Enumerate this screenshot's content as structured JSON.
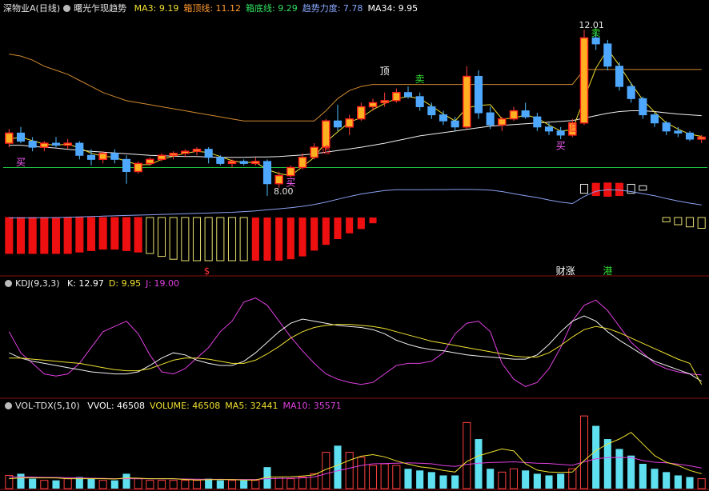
{
  "panels": {
    "main": {
      "security": "深物业A(日线)",
      "indicator": "曙光乍现趋势",
      "stats": [
        {
          "label": "MA3",
          "value": "9.19",
          "color": "#f0e030"
        },
        {
          "label": "箱顶线",
          "value": "11.12",
          "color": "#ff9a30"
        },
        {
          "label": "箱底线",
          "value": "9.29",
          "color": "#30e060"
        },
        {
          "label": "趋势力度",
          "value": "7.78",
          "color": "#8aa8ff"
        },
        {
          "label": "MA34",
          "value": "9.95",
          "color": "#ffffff"
        }
      ]
    },
    "kdj": {
      "name": "KDJ(9,3,3)",
      "stats": [
        {
          "label": "K",
          "value": "12.97",
          "color": "#ffffff"
        },
        {
          "label": "D",
          "value": "9.95",
          "color": "#f0e030"
        },
        {
          "label": "J",
          "value": "19.00",
          "color": "#e040e0"
        }
      ]
    },
    "vol": {
      "name": "VOL-TDX(5,10)",
      "stats": [
        {
          "label": "VVOL",
          "value": "46508",
          "color": "#ffffff"
        },
        {
          "label": "VOLUME",
          "value": "46508",
          "color": "#f0e030"
        },
        {
          "label": "MA5",
          "value": "32441",
          "color": "#f0e030"
        },
        {
          "label": "MA10",
          "value": "35571",
          "color": "#e040e0"
        }
      ]
    }
  },
  "chart_data": {
    "type": "candlestick",
    "count": 60,
    "price_range": [
      7.9,
      12.4
    ],
    "candles": [
      {
        "o": 9.3,
        "h": 9.65,
        "l": 9.2,
        "c": 9.55
      },
      {
        "o": 9.55,
        "h": 9.7,
        "l": 9.3,
        "c": 9.35
      },
      {
        "o": 9.35,
        "h": 9.45,
        "l": 9.1,
        "c": 9.2
      },
      {
        "o": 9.2,
        "h": 9.35,
        "l": 9.1,
        "c": 9.3
      },
      {
        "o": 9.3,
        "h": 9.45,
        "l": 9.2,
        "c": 9.25
      },
      {
        "o": 9.25,
        "h": 9.4,
        "l": 9.15,
        "c": 9.3
      },
      {
        "o": 9.3,
        "h": 9.35,
        "l": 8.9,
        "c": 9.0
      },
      {
        "o": 9.0,
        "h": 9.15,
        "l": 8.75,
        "c": 8.9
      },
      {
        "o": 8.9,
        "h": 9.1,
        "l": 8.8,
        "c": 9.05
      },
      {
        "o": 9.05,
        "h": 9.15,
        "l": 8.8,
        "c": 8.9
      },
      {
        "o": 8.9,
        "h": 9.0,
        "l": 8.3,
        "c": 8.6
      },
      {
        "o": 8.6,
        "h": 8.85,
        "l": 8.55,
        "c": 8.8
      },
      {
        "o": 8.8,
        "h": 8.95,
        "l": 8.75,
        "c": 8.9
      },
      {
        "o": 8.9,
        "h": 9.05,
        "l": 8.85,
        "c": 9.0
      },
      {
        "o": 9.0,
        "h": 9.1,
        "l": 8.9,
        "c": 9.05
      },
      {
        "o": 9.05,
        "h": 9.15,
        "l": 8.95,
        "c": 9.1
      },
      {
        "o": 9.1,
        "h": 9.2,
        "l": 9.0,
        "c": 9.15
      },
      {
        "o": 9.15,
        "h": 9.2,
        "l": 8.8,
        "c": 8.95
      },
      {
        "o": 8.95,
        "h": 9.0,
        "l": 8.75,
        "c": 8.8
      },
      {
        "o": 8.8,
        "h": 8.9,
        "l": 8.7,
        "c": 8.85
      },
      {
        "o": 8.85,
        "h": 8.9,
        "l": 8.75,
        "c": 8.8
      },
      {
        "o": 8.8,
        "h": 8.95,
        "l": 8.75,
        "c": 8.85
      },
      {
        "o": 8.85,
        "h": 8.9,
        "l": 8.0,
        "c": 8.3
      },
      {
        "o": 8.3,
        "h": 8.6,
        "l": 8.2,
        "c": 8.5
      },
      {
        "o": 8.5,
        "h": 8.75,
        "l": 8.45,
        "c": 8.7
      },
      {
        "o": 8.7,
        "h": 9.05,
        "l": 8.65,
        "c": 8.95
      },
      {
        "o": 8.95,
        "h": 9.3,
        "l": 8.9,
        "c": 9.2
      },
      {
        "o": 9.2,
        "h": 9.9,
        "l": 9.15,
        "c": 9.85
      },
      {
        "o": 9.85,
        "h": 10.25,
        "l": 9.6,
        "c": 9.7
      },
      {
        "o": 9.7,
        "h": 10.0,
        "l": 9.5,
        "c": 9.9
      },
      {
        "o": 9.9,
        "h": 10.3,
        "l": 9.85,
        "c": 10.2
      },
      {
        "o": 10.2,
        "h": 10.4,
        "l": 10.1,
        "c": 10.3
      },
      {
        "o": 10.3,
        "h": 10.55,
        "l": 10.2,
        "c": 10.35
      },
      {
        "o": 10.35,
        "h": 10.65,
        "l": 10.3,
        "c": 10.55
      },
      {
        "o": 10.55,
        "h": 10.7,
        "l": 10.4,
        "c": 10.45
      },
      {
        "o": 10.45,
        "h": 10.55,
        "l": 10.1,
        "c": 10.2
      },
      {
        "o": 10.2,
        "h": 10.3,
        "l": 9.9,
        "c": 10.0
      },
      {
        "o": 10.0,
        "h": 10.1,
        "l": 9.75,
        "c": 9.85
      },
      {
        "o": 9.85,
        "h": 9.95,
        "l": 9.6,
        "c": 9.7
      },
      {
        "o": 9.7,
        "h": 11.2,
        "l": 9.65,
        "c": 10.95
      },
      {
        "o": 10.95,
        "h": 11.1,
        "l": 9.9,
        "c": 10.05
      },
      {
        "o": 10.05,
        "h": 10.2,
        "l": 9.65,
        "c": 9.75
      },
      {
        "o": 9.75,
        "h": 9.95,
        "l": 9.6,
        "c": 9.9
      },
      {
        "o": 9.9,
        "h": 10.2,
        "l": 9.85,
        "c": 10.1
      },
      {
        "o": 10.1,
        "h": 10.3,
        "l": 9.9,
        "c": 9.95
      },
      {
        "o": 9.95,
        "h": 10.05,
        "l": 9.6,
        "c": 9.7
      },
      {
        "o": 9.7,
        "h": 9.8,
        "l": 9.5,
        "c": 9.6
      },
      {
        "o": 9.6,
        "h": 9.7,
        "l": 9.4,
        "c": 9.5
      },
      {
        "o": 9.5,
        "h": 9.9,
        "l": 9.45,
        "c": 9.8
      },
      {
        "o": 9.8,
        "h": 12.1,
        "l": 9.75,
        "c": 11.9
      },
      {
        "o": 11.9,
        "h": 12.05,
        "l": 11.6,
        "c": 11.75
      },
      {
        "o": 11.75,
        "h": 11.85,
        "l": 11.1,
        "c": 11.2
      },
      {
        "o": 11.2,
        "h": 11.3,
        "l": 10.6,
        "c": 10.7
      },
      {
        "o": 10.7,
        "h": 10.8,
        "l": 10.3,
        "c": 10.4
      },
      {
        "o": 10.4,
        "h": 10.45,
        "l": 9.9,
        "c": 10.0
      },
      {
        "o": 10.0,
        "h": 10.05,
        "l": 9.7,
        "c": 9.8
      },
      {
        "o": 9.8,
        "h": 9.85,
        "l": 9.5,
        "c": 9.6
      },
      {
        "o": 9.6,
        "h": 9.7,
        "l": 9.45,
        "c": 9.55
      },
      {
        "o": 9.55,
        "h": 9.6,
        "l": 9.35,
        "c": 9.4
      },
      {
        "o": 9.4,
        "h": 9.5,
        "l": 9.3,
        "c": 9.45
      }
    ],
    "ma3": [
      9.4,
      9.45,
      9.36,
      9.28,
      9.25,
      9.28,
      9.18,
      9.05,
      8.98,
      8.95,
      8.85,
      8.77,
      8.77,
      8.9,
      8.98,
      9.05,
      9.1,
      9.07,
      8.97,
      8.87,
      8.82,
      8.83,
      8.65,
      8.55,
      8.5,
      8.72,
      8.95,
      9.33,
      9.58,
      9.82,
      9.93,
      10.13,
      10.28,
      10.4,
      10.45,
      10.4,
      10.22,
      10.02,
      9.85,
      10.17,
      10.23,
      10.25,
      9.9,
      9.92,
      10.0,
      9.92,
      9.75,
      9.6,
      9.63,
      10.4,
      11.15,
      11.62,
      11.22,
      10.77,
      10.37,
      10.07,
      9.8,
      9.65,
      9.52,
      9.47
    ],
    "ma34": [
      9.25,
      9.25,
      9.22,
      9.2,
      9.18,
      9.15,
      9.13,
      9.1,
      9.08,
      9.06,
      9.04,
      9.02,
      9.0,
      8.99,
      8.98,
      8.97,
      8.97,
      8.96,
      8.95,
      8.95,
      8.95,
      8.96,
      8.96,
      8.97,
      8.99,
      9.01,
      9.04,
      9.08,
      9.12,
      9.16,
      9.2,
      9.25,
      9.3,
      9.36,
      9.42,
      9.48,
      9.52,
      9.56,
      9.6,
      9.64,
      9.68,
      9.72,
      9.74,
      9.76,
      9.78,
      9.8,
      9.82,
      9.84,
      9.86,
      9.92,
      9.98,
      10.04,
      10.08,
      10.1,
      10.1,
      10.08,
      10.05,
      10.02,
      10.0,
      9.98
    ],
    "box_top": [
      11.5,
      11.45,
      11.35,
      11.2,
      11.1,
      11.0,
      10.85,
      10.7,
      10.55,
      10.45,
      10.35,
      10.3,
      10.25,
      10.2,
      10.15,
      10.1,
      10.05,
      10.0,
      9.95,
      9.9,
      9.85,
      9.85,
      9.85,
      9.85,
      9.85,
      9.85,
      9.85,
      10.1,
      10.4,
      10.6,
      10.7,
      10.75,
      10.75,
      10.75,
      10.75,
      10.75,
      10.75,
      10.75,
      10.75,
      10.75,
      10.75,
      10.75,
      10.75,
      10.75,
      10.75,
      10.75,
      10.75,
      10.75,
      10.75,
      11.12,
      11.12,
      11.12,
      11.12,
      11.12,
      11.12,
      11.12,
      11.12,
      11.12,
      11.12,
      11.12
    ],
    "box_bottom_level": 8.7,
    "trend": [
      1.7,
      1.7,
      1.72,
      1.75,
      1.8,
      1.9,
      2.0,
      2.1,
      2.2,
      2.3,
      2.4,
      2.5,
      2.6,
      2.7,
      2.8,
      2.9,
      3.0,
      3.1,
      3.2,
      3.3,
      3.5,
      3.7,
      4.0,
      4.3,
      4.6,
      5.0,
      5.5,
      6.2,
      7.0,
      7.8,
      8.5,
      9.0,
      9.5,
      9.7,
      9.7,
      9.7,
      9.75,
      9.75,
      9.8,
      9.8,
      9.75,
      9.6,
      9.2,
      8.6,
      8.0,
      7.5,
      6.8,
      6.2,
      5.8,
      7.8,
      9.3,
      9.7,
      9.6,
      9.2,
      8.6,
      8.0,
      7.2,
      6.5,
      5.9,
      5.4
    ],
    "hist": [
      -5,
      -5,
      -5,
      -5,
      -5,
      -5,
      -4.8,
      -4.6,
      -4.4,
      -4.4,
      -4.6,
      -4.8,
      -5,
      -5.4,
      -5.8,
      -6,
      -6,
      -6,
      -6,
      -6,
      -6,
      -6,
      -6,
      -6,
      -5.8,
      -5.4,
      -4.6,
      -3.8,
      -3.0,
      -2.2,
      -1.6,
      -0.8,
      0,
      0,
      0,
      0,
      0,
      0,
      0,
      0,
      0,
      0,
      0,
      0,
      0,
      0,
      0,
      0,
      0,
      1.6,
      2.2,
      2.4,
      2.2,
      1.6,
      0.8,
      0,
      -0.6,
      -1.0,
      -1.3,
      -1.5
    ],
    "kdj": {
      "k": [
        40,
        35,
        32,
        30,
        28,
        26,
        24,
        22,
        21,
        20,
        20,
        22,
        28,
        35,
        40,
        38,
        33,
        30,
        28,
        28,
        32,
        40,
        50,
        60,
        68,
        72,
        70,
        68,
        66,
        65,
        64,
        62,
        58,
        52,
        48,
        45,
        43,
        42,
        40,
        38,
        37,
        36,
        35,
        34,
        34,
        38,
        48,
        60,
        70,
        75,
        70,
        60,
        52,
        45,
        38,
        32,
        28,
        24,
        20,
        13
      ],
      "d": [
        35,
        35,
        34,
        33,
        32,
        31,
        30,
        28,
        26,
        24,
        23,
        23,
        25,
        29,
        33,
        35,
        35,
        34,
        32,
        30,
        30,
        33,
        39,
        46,
        54,
        60,
        64,
        66,
        67,
        67,
        66,
        65,
        63,
        60,
        57,
        54,
        51,
        49,
        47,
        45,
        43,
        41,
        39,
        37,
        36,
        36,
        40,
        47,
        55,
        62,
        65,
        63,
        59,
        54,
        49,
        44,
        39,
        34,
        30,
        10
      ],
      "j": [
        60,
        40,
        30,
        20,
        18,
        20,
        30,
        45,
        60,
        65,
        70,
        58,
        38,
        22,
        20,
        25,
        35,
        45,
        60,
        70,
        88,
        92,
        85,
        70,
        55,
        42,
        30,
        20,
        15,
        12,
        10,
        12,
        20,
        28,
        30,
        30,
        32,
        40,
        58,
        68,
        70,
        60,
        30,
        15,
        8,
        12,
        25,
        45,
        70,
        85,
        90,
        80,
        65,
        50,
        40,
        30,
        25,
        22,
        20,
        19
      ]
    },
    "volume": {
      "bars": [
        8,
        9,
        6,
        5,
        5,
        6,
        7,
        6,
        5,
        5,
        9,
        6,
        5,
        5,
        5,
        5,
        5,
        6,
        5,
        5,
        5,
        5,
        13,
        7,
        6,
        7,
        9,
        22,
        26,
        22,
        19,
        14,
        15,
        14,
        12,
        11,
        10,
        8,
        8,
        40,
        30,
        12,
        10,
        12,
        11,
        9,
        8,
        9,
        12,
        44,
        38,
        30,
        24,
        20,
        15,
        12,
        10,
        8,
        7,
        6
      ],
      "up": [
        1,
        0,
        0,
        1,
        0,
        1,
        0,
        0,
        1,
        0,
        0,
        1,
        1,
        1,
        1,
        1,
        1,
        0,
        0,
        1,
        0,
        1,
        0,
        1,
        1,
        1,
        1,
        1,
        0,
        1,
        1,
        1,
        1,
        1,
        0,
        0,
        0,
        0,
        0,
        1,
        0,
        0,
        1,
        1,
        0,
        0,
        0,
        0,
        1,
        1,
        0,
        0,
        0,
        0,
        0,
        0,
        0,
        0,
        0,
        1
      ],
      "ma5": [
        6,
        6.5,
        6.5,
        6.5,
        6.5,
        6,
        6,
        6,
        6,
        5.8,
        6.5,
        6.3,
        6,
        6,
        6,
        5.5,
        5.2,
        5.4,
        5.4,
        5.4,
        5.2,
        5.2,
        7,
        7,
        7.2,
        7.6,
        8.4,
        11.6,
        14.2,
        17.2,
        19.6,
        20.6,
        19.2,
        16.8,
        14.8,
        13.2,
        12.4,
        11,
        10,
        16.4,
        19.8,
        22,
        24,
        22.8,
        15,
        11.2,
        10,
        9.8,
        10,
        17,
        23,
        27,
        30,
        34,
        27,
        20,
        16,
        14,
        11,
        9
      ],
      "ma10": [
        7,
        7,
        7,
        6.8,
        6.8,
        6.6,
        6.5,
        6.3,
        6.2,
        6,
        6,
        6,
        5.9,
        5.9,
        5.9,
        5.8,
        5.7,
        5.6,
        5.6,
        5.5,
        5.5,
        5.5,
        6,
        6.2,
        6.3,
        6.5,
        7,
        9,
        10.8,
        12.4,
        14,
        15,
        15.2,
        15.4,
        15.6,
        15.4,
        15,
        14,
        13.4,
        14.6,
        15.4,
        15.8,
        16,
        16.2,
        15.8,
        15.4,
        15.2,
        14.6,
        14.2,
        16.2,
        18,
        18.8,
        18.9,
        18.8,
        17,
        16,
        15.6,
        14.8,
        13.8,
        12.5
      ],
      "range": [
        0,
        46
      ]
    },
    "annotations": {
      "price_labels": [
        {
          "text": "12.01",
          "index": 48,
          "price": 12.1
        },
        {
          "text": "8.00",
          "index": 22,
          "price": 8.0
        }
      ],
      "signals": [
        {
          "text": "买",
          "index": 1,
          "color": "#ff60ff",
          "price": 8.75
        },
        {
          "text": "买",
          "index": 24,
          "color": "#ff60ff",
          "price": 8.25
        },
        {
          "text": "买",
          "index": 47,
          "color": "#ff60ff",
          "price": 9.15
        },
        {
          "text": "顶",
          "index": 32,
          "color": "#ffffff",
          "price": 11.0
        },
        {
          "text": "卖",
          "index": 35,
          "color": "#30e030",
          "price": 10.8
        },
        {
          "text": "卖",
          "index": 50,
          "color": "#30e030",
          "price": 11.95
        },
        {
          "text": "追",
          "index": 27,
          "color": "#ff3030",
          "price": 9.05
        },
        {
          "text": "追",
          "index": 48,
          "color": "#ff3030",
          "price": 9.6
        }
      ],
      "bottom_tags": [
        {
          "text": "$",
          "index": 17,
          "color": "#ff3030"
        },
        {
          "text": "财涨",
          "index": 47,
          "color": "#ffffff"
        },
        {
          "text": "港",
          "index": 51,
          "color": "#30e030"
        }
      ]
    }
  }
}
